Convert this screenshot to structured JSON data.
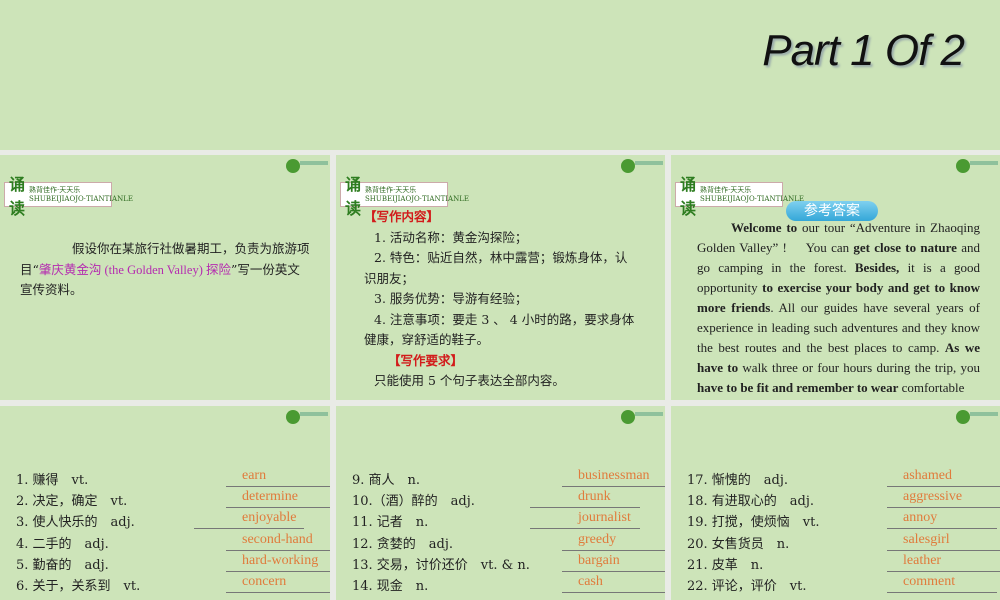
{
  "title": "Part 1 Of 2",
  "badge": {
    "big": "诵读",
    "line1": "熟背佳作·天天乐",
    "line2": "SHUBEIJIAOJO·TIANTIANLE"
  },
  "panel1": {
    "pre": "假设你在某旅行社做暑期工，负责为旅游项目“",
    "highlight": "肇庆黄金沟 (the Golden Valley) 探险",
    "post": "”写一份英文宣传资料。"
  },
  "panel2": {
    "h1": "【写作内容】",
    "items": [
      "1. 活动名称：黄金沟探险；",
      "2. 特色：贴近自然，林中露营；锻炼身体，认识朋友；",
      "3. 服务优势：导游有经验；",
      "4. 注意事项：要走 3 、 4 小时的路，要求身体健康，穿舒适的鞋子。"
    ],
    "h2": "【写作要求】",
    "req": "只能使用 5 个句子表达全部内容。"
  },
  "panel3": {
    "answer_label": "参考答案",
    "segments": [
      [
        "b",
        "Welcome to"
      ],
      [
        "n",
        " our tour “Adventure in Zhaoqing Golden Valley” !　 You can "
      ],
      [
        "b",
        "get close to nature"
      ],
      [
        "n",
        " and go camping in the forest. "
      ],
      [
        "b",
        "Besides,"
      ],
      [
        "n",
        " it is a good opportunity "
      ],
      [
        "b",
        "to exercise your body and get to know more friends"
      ],
      [
        "n",
        ". All our guides have several years of experience in leading such adventures and they know the best routes and the best places to camp. "
      ],
      [
        "b",
        "As we have to"
      ],
      [
        "n",
        " walk three or four hours during the trip, you "
      ],
      [
        "b",
        "have to be fit and remember to wear"
      ],
      [
        "n",
        " comfortable"
      ]
    ]
  },
  "vocab": [
    [
      [
        "1. 赚得　vt.",
        "earn"
      ],
      [
        "2. 决定，确定　vt.",
        "determine"
      ],
      [
        "3. 使人快乐的　adj.",
        "enjoyable"
      ],
      [
        "4. 二手的　adj.",
        "second-hand"
      ],
      [
        "5. 勤奋的　adj.",
        "hard-working"
      ],
      [
        "6. 关于，关系到　vt.",
        "concern"
      ]
    ],
    [
      [
        "9. 商人　n.",
        "businessman"
      ],
      [
        "10.（酒）醉的　adj.",
        "drunk"
      ],
      [
        "11. 记者　n.",
        "journalist"
      ],
      [
        "12. 贪婪的　adj.",
        "greedy"
      ],
      [
        "13. 交易，讨价还价　vt. & n.",
        "bargain"
      ],
      [
        "14. 现金　n.",
        "cash"
      ]
    ],
    [
      [
        "17. 惭愧的　adj.",
        "ashamed"
      ],
      [
        "18. 有进取心的　adj.",
        "aggressive"
      ],
      [
        "19. 打搅，使烦恼　vt.",
        "annoy"
      ],
      [
        "20. 女售货员　n.",
        "salesgirl"
      ],
      [
        "21. 皮革　n.",
        "leather"
      ],
      [
        "22. 评论，评价　vt.",
        "comment"
      ]
    ]
  ]
}
